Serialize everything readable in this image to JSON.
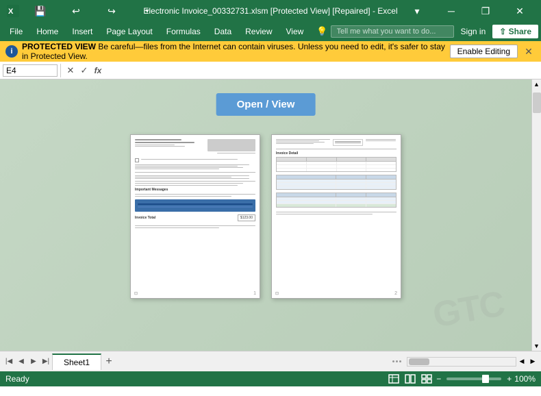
{
  "titlebar": {
    "save_icon": "💾",
    "undo_icon": "↩",
    "redo_icon": "↪",
    "dropdown_icon": "▾",
    "title": "Electronic Invoice_00332731.xlsm  [Protected View]  [Repaired] - Excel",
    "minimize_icon": "─",
    "restore_icon": "❐",
    "close_icon": "✕",
    "ribbon_icon": "▾"
  },
  "menubar": {
    "items": [
      "File",
      "Home",
      "Insert",
      "Page Layout",
      "Formulas",
      "Data",
      "Review",
      "View"
    ],
    "tell_placeholder": "Tell me what you want to do...",
    "tell_icon": "💡",
    "signin_label": "Sign in",
    "share_label": "⇧ Share"
  },
  "protected_bar": {
    "icon": "i",
    "label_bold": "PROTECTED VIEW",
    "message": "Be careful—files from the Internet can contain viruses. Unless you need to edit, it's safer to stay in Protected View.",
    "enable_label": "Enable Editing",
    "close_icon": "✕"
  },
  "formula_bar": {
    "name_box": "E4",
    "cancel_icon": "✕",
    "confirm_icon": "✓",
    "fx_icon": "fx"
  },
  "content": {
    "open_view_label": "Open / View",
    "watermark": "GTC",
    "doc1_page": "1",
    "doc2_page": "2"
  },
  "tabs": {
    "sheet_name": "Sheet1",
    "add_icon": "+"
  },
  "status": {
    "ready": "Ready",
    "zoom": "100%"
  }
}
